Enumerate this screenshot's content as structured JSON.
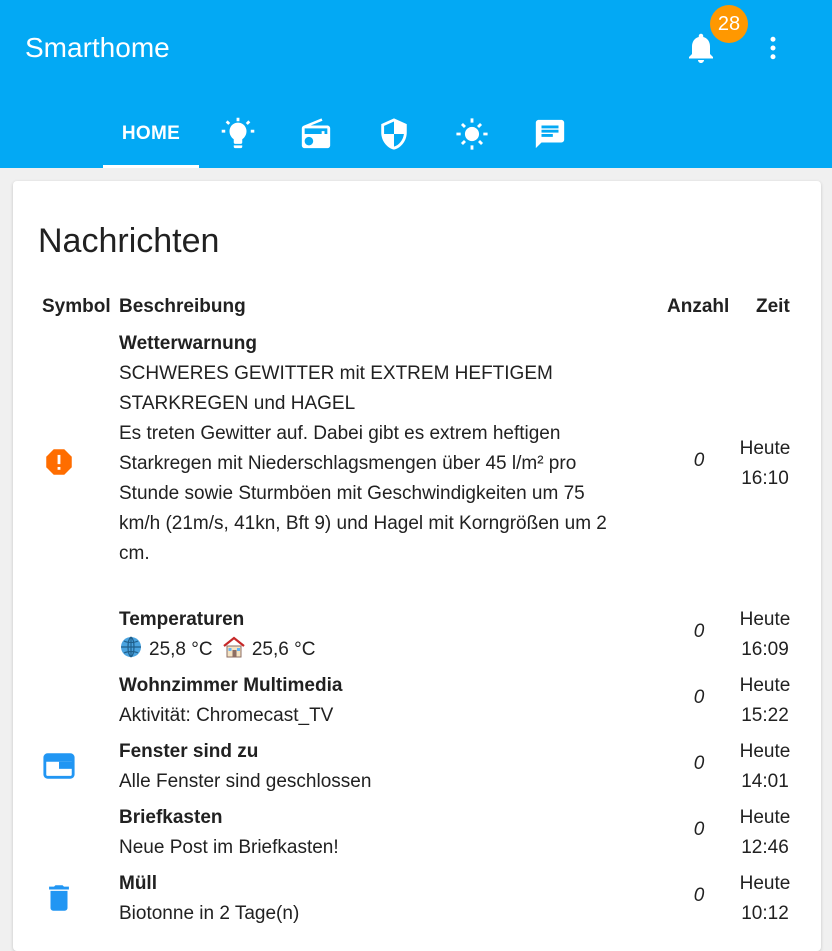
{
  "app": {
    "title": "Smarthome",
    "notifications_count": "28"
  },
  "tabs": {
    "home": "HOME",
    "icons": [
      "lightbulb-icon",
      "radio-icon",
      "shield-icon",
      "sun-icon",
      "message-icon"
    ]
  },
  "colors": {
    "header": "#03a9f4",
    "badge": "#ff9800",
    "warning_icon": "#ff6d00",
    "blue_icon": "#2196f3"
  },
  "card": {
    "title": "Nachrichten",
    "columns": {
      "symbol": "Symbol",
      "description": "Beschreibung",
      "count": "Anzahl",
      "time": "Zeit"
    },
    "rows": [
      {
        "icon": "alert-octagon-icon",
        "title": "Wetterwarnung",
        "lines": [
          "SCHWERES GEWITTER mit EXTREM HEFTIGEM",
          "STARKREGEN und HAGEL",
          "Es treten Gewitter auf. Dabei gibt es extrem heftigen",
          "Starkregen mit Niederschlagsmengen über 45 l/m² pro",
          "Stunde sowie Sturmböen mit Geschwindigkeiten um 75",
          "km/h (21m/s, 41kn, Bft 9) und Hagel mit Korngrößen um 2",
          "cm."
        ],
        "count": "0",
        "time_day": "Heute",
        "time_clock": "16:10"
      },
      {
        "icon": "",
        "title": "Temperaturen",
        "outside_value": "25,8 °C",
        "inside_value": "25,6 °C",
        "count": "0",
        "time_day": "Heute",
        "time_clock": "16:09"
      },
      {
        "icon": "",
        "title": "Wohnzimmer Multimedia",
        "text": "Aktivität: Chromecast_TV",
        "count": "0",
        "time_day": "Heute",
        "time_clock": "15:22"
      },
      {
        "icon": "window-closed-icon",
        "title": "Fenster sind zu",
        "text": "Alle Fenster sind geschlossen",
        "count": "0",
        "time_day": "Heute",
        "time_clock": "14:01"
      },
      {
        "icon": "",
        "title": "Briefkasten",
        "text": "Neue Post im Briefkasten!",
        "count": "0",
        "time_day": "Heute",
        "time_clock": "12:46"
      },
      {
        "icon": "trash-can-icon",
        "title": "Müll",
        "text": "Biotonne in 2 Tage(n)",
        "count": "0",
        "time_day": "Heute",
        "time_clock": "10:12"
      }
    ]
  }
}
